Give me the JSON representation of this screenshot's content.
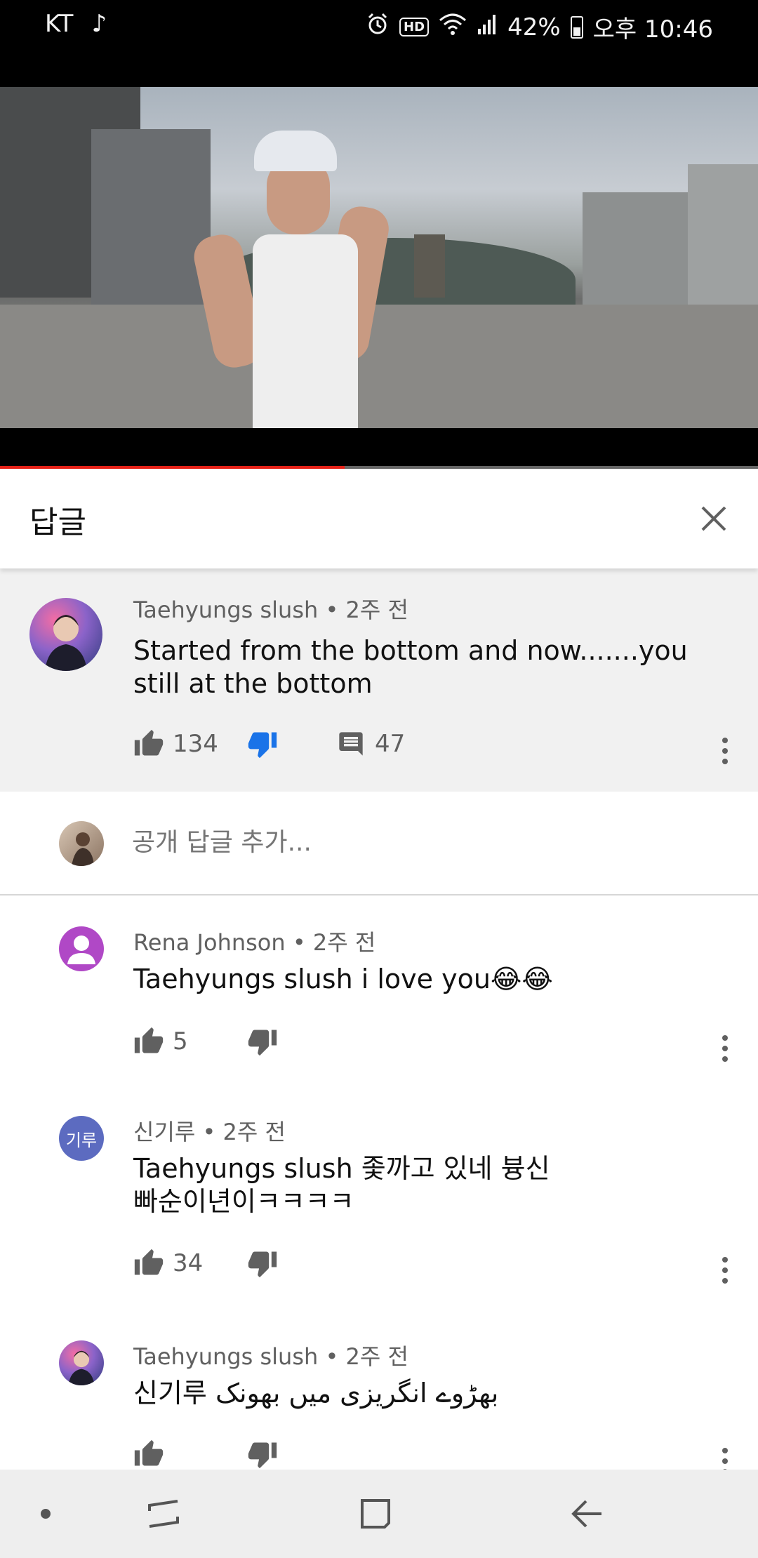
{
  "status_bar": {
    "carrier": "KT",
    "music_icon": "music-note-icon",
    "hd_label": "HD",
    "battery": "42%",
    "time": "오후 10:46"
  },
  "video": {
    "progress_fraction": 0.455,
    "progress_color": "#e62117"
  },
  "replies_panel": {
    "title": "답글",
    "close_icon": "close-icon"
  },
  "parent_comment": {
    "author": "Taehyungs slush",
    "time": "2주 전",
    "text": "Started from the bottom and now.......you still at the bottom",
    "likes": "134",
    "replies": "47",
    "dislike_active_color": "#1a73e8"
  },
  "add_reply": {
    "placeholder": "공개 답글 추가..."
  },
  "replies": [
    {
      "author": "Rena Johnson",
      "time": "2주 전",
      "text": "Taehyungs slush i love you😂😂",
      "likes": "5",
      "avatar_color": "#b048c6"
    },
    {
      "author": "신기루",
      "time": "2주 전",
      "text": "Taehyungs slush 좇까고 있네 븅신 빠순이년이ㅋㅋㅋㅋ",
      "likes": "34",
      "avatar_text": "기루",
      "avatar_color": "#5c6bc0"
    },
    {
      "author": "Taehyungs slush",
      "time": "2주 전",
      "text": "신기루 بھڑوے انگریزی میں بھونک",
      "likes": ""
    }
  ],
  "nav_bar": {
    "items": [
      "dot-icon",
      "recent-apps-icon",
      "home-icon",
      "back-icon"
    ]
  }
}
